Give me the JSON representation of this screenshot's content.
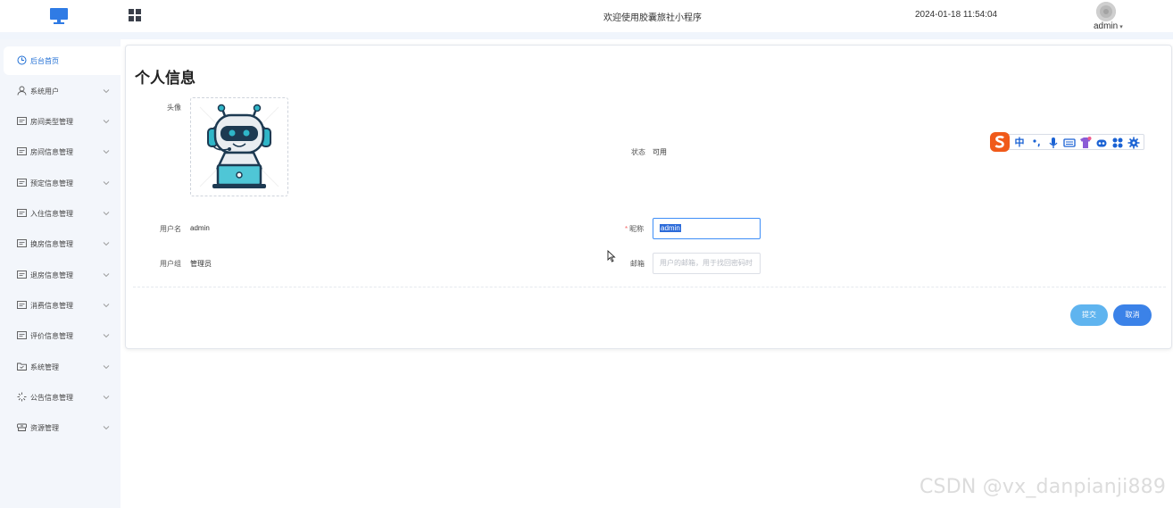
{
  "header": {
    "title": "欢迎使用胶囊旅社小程序",
    "datetime": "2024-01-18 11:54:04",
    "username": "admin",
    "caret": "▾"
  },
  "sidebar": {
    "items": [
      {
        "label": "后台首页",
        "icon": "clock-icon",
        "active": true
      },
      {
        "label": "系统用户",
        "icon": "user-icon"
      },
      {
        "label": "房间类型管理",
        "icon": "card-icon"
      },
      {
        "label": "房间信息管理",
        "icon": "card-icon"
      },
      {
        "label": "预定信息管理",
        "icon": "card-icon"
      },
      {
        "label": "入住信息管理",
        "icon": "card-icon"
      },
      {
        "label": "换房信息管理",
        "icon": "card-icon"
      },
      {
        "label": "退房信息管理",
        "icon": "card-icon"
      },
      {
        "label": "消费信息管理",
        "icon": "card-icon"
      },
      {
        "label": "评价信息管理",
        "icon": "card-icon"
      },
      {
        "label": "系统管理",
        "icon": "folder-icon"
      },
      {
        "label": "公告信息管理",
        "icon": "loading-icon"
      },
      {
        "label": "资源管理",
        "icon": "box-icon"
      }
    ]
  },
  "profile": {
    "title": "个人信息",
    "avatar_label": "头像",
    "status_label": "状态",
    "status_value": "可用",
    "username_label": "用户名",
    "username_value": "admin",
    "group_label": "用户组",
    "group_value": "管理员",
    "nickname_label": "昵称",
    "nickname_required": "*",
    "nickname_value": "admin",
    "email_label": "邮箱",
    "email_placeholder": "用户的邮箱，用于找回密码时",
    "submit_label": "提交",
    "cancel_label": "取消"
  },
  "ime": {
    "mode_label": "中",
    "items": [
      "sogou-logo-icon",
      "punctuation-icon",
      "microphone-icon",
      "keyboard-icon",
      "skin-icon",
      "robot-icon",
      "apps-icon",
      "settings-icon"
    ]
  },
  "watermark": "CSDN @vx_danpianji889",
  "colors": {
    "accent": "#1f6ed4",
    "submit": "#5fb4ef",
    "cancel": "#3b82e8",
    "sidebar_bg": "#f3f6fb",
    "required": "#f56c6c"
  }
}
